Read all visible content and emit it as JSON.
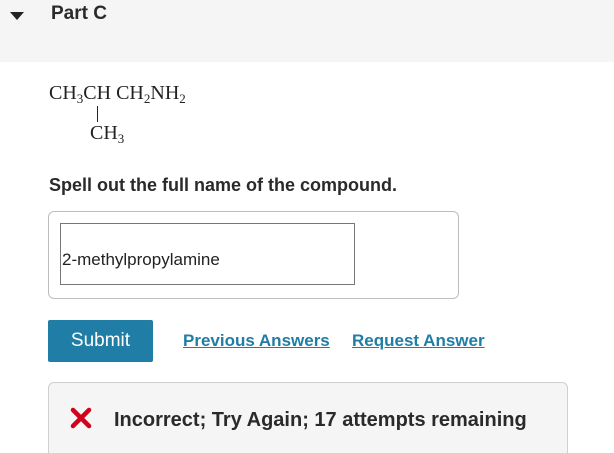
{
  "part": {
    "title": "Part C"
  },
  "formula": {
    "top": [
      "CH",
      "3",
      "CH CH",
      "2",
      "NH",
      "2"
    ],
    "branch": [
      "CH",
      "3"
    ]
  },
  "question": {
    "prompt": "Spell out the full name of the compound."
  },
  "answer": {
    "value": "2-methylpropylamine"
  },
  "actions": {
    "submit_label": "Submit",
    "previous_answers_label": "Previous Answers",
    "request_answer_label": "Request Answer"
  },
  "feedback": {
    "message": "Incorrect; Try Again; 17 attempts remaining",
    "icon": "x-icon",
    "icon_color": "#d0021b"
  },
  "colors": {
    "accent": "#1f7da6",
    "header_bg": "#f5f5f5"
  }
}
